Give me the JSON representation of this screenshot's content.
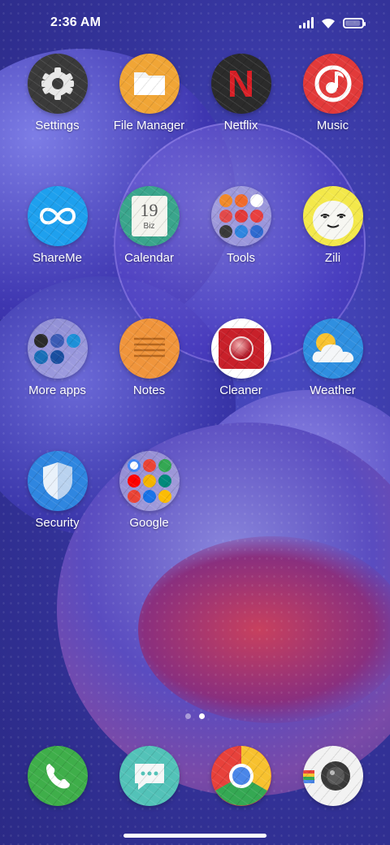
{
  "status_bar": {
    "time": "2:36 AM"
  },
  "colors": {
    "settings": "#3a3a3a",
    "file_manager": "#f0a536",
    "netflix": "#2b2b2b",
    "netflix_red": "#d81f26",
    "music": "#e23a3a",
    "shareme": "#1ea0ee",
    "calendar": "#3aa58c",
    "zili": "#f3e84a",
    "notes": "#f0953c",
    "cleaner": "#ffffff",
    "weather": "#2f8fe0",
    "security": "#2f86e0",
    "phone": "#3fae4a",
    "messages": "#53c2b8",
    "chrome_red": "#e7413b",
    "chrome_yellow": "#f7c12f",
    "chrome_green": "#35a853",
    "chrome_blue": "#4a86e8"
  },
  "apps": [
    {
      "label": "Settings",
      "icon": "settings-icon"
    },
    {
      "label": "File Manager",
      "icon": "file-manager-icon"
    },
    {
      "label": "Netflix",
      "icon": "netflix-icon",
      "glyph": "N"
    },
    {
      "label": "Music",
      "icon": "music-icon"
    },
    {
      "label": "ShareMe",
      "icon": "shareme-icon",
      "glyph": "∞"
    },
    {
      "label": "Calendar",
      "icon": "calendar-icon",
      "day": "19",
      "weekday": "Biz"
    },
    {
      "label": "Tools",
      "icon": "tools-folder-icon"
    },
    {
      "label": "Zili",
      "icon": "zili-icon"
    },
    {
      "label": "More apps",
      "icon": "more-apps-folder-icon"
    },
    {
      "label": "Notes",
      "icon": "notes-icon"
    },
    {
      "label": "Cleaner",
      "icon": "cleaner-icon"
    },
    {
      "label": "Weather",
      "icon": "weather-icon"
    },
    {
      "label": "Security",
      "icon": "security-icon"
    },
    {
      "label": "Google",
      "icon": "google-folder-icon"
    }
  ],
  "dock": [
    {
      "icon": "phone-icon"
    },
    {
      "icon": "messages-icon"
    },
    {
      "icon": "chrome-icon"
    },
    {
      "icon": "camera-icon"
    }
  ],
  "pages": {
    "count": 2,
    "current": 2
  }
}
